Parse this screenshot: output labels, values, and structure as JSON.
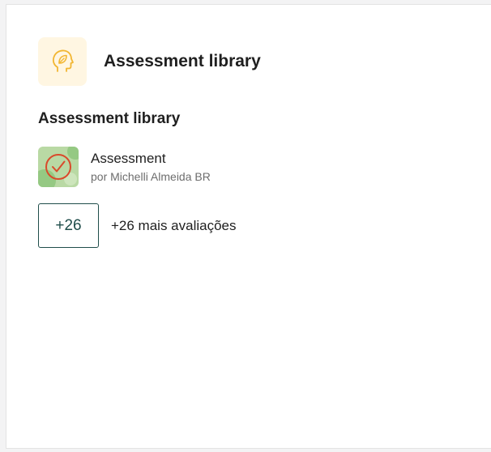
{
  "header": {
    "title": "Assessment library",
    "icon": "head-leaf-icon",
    "icon_color": "#f2b632",
    "icon_bg": "#fff6e2"
  },
  "section": {
    "title": "Assessment library"
  },
  "items": [
    {
      "title": "Assessment",
      "author": "por Michelli Almeida BR",
      "icon": "check-circle-icon"
    }
  ],
  "more": {
    "badge": "+26",
    "label": "+26 mais avaliações"
  },
  "colors": {
    "accent": "#1f4d4a",
    "check": "#d94a2b",
    "thumb_bg": "#b9d9a4"
  }
}
